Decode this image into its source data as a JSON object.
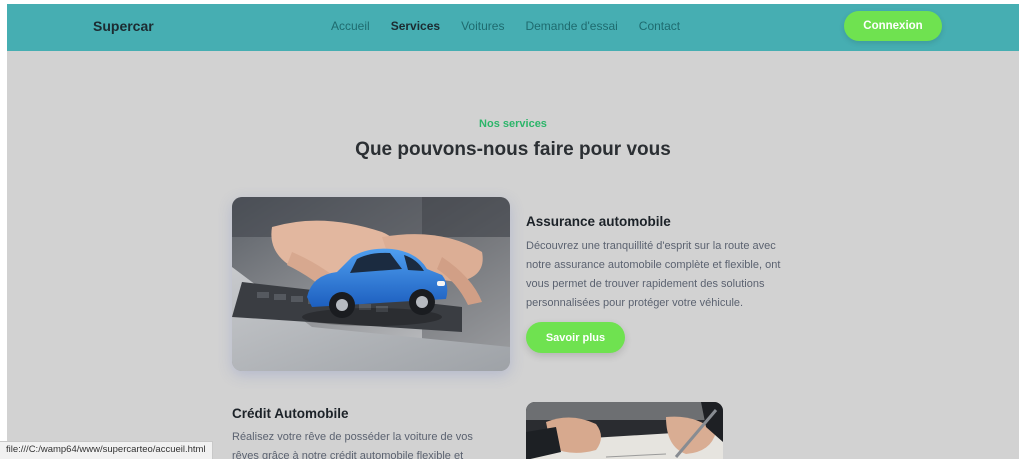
{
  "navbar": {
    "brand": "Supercar",
    "links": [
      {
        "label": "Accueil"
      },
      {
        "label": "Services"
      },
      {
        "label": "Voitures"
      },
      {
        "label": "Demande d'essai"
      },
      {
        "label": "Contact"
      }
    ],
    "active_link": "Services",
    "login_label": "Connexion"
  },
  "section": {
    "eyebrow": "Nos services",
    "title": "Que pouvons-nous faire pour vous"
  },
  "services": [
    {
      "title": "Assurance automobile",
      "description_lines": [
        "Découvrez une tranquillité d'esprit sur la route avec",
        "notre assurance automobile complète et flexible, ont",
        "vous permet de trouver rapidement des solutions",
        "personnalisées pour protéger votre véhicule."
      ],
      "button_label": "Savoir plus"
    },
    {
      "title": "Crédit Automobile",
      "description_lines": [
        "Réalisez votre rêve de posséder la voiture de vos",
        "rêves grâce à notre crédit automobile flexible et"
      ]
    }
  ],
  "status_bar": {
    "url": "file:///C:/wamp64/www/supercarteo/accueil.html"
  },
  "colors": {
    "navbar": "#46aeb2",
    "accent_green": "#6fe250",
    "eyebrow_green": "#2cb56a",
    "page_bg": "#d2d2d2"
  }
}
